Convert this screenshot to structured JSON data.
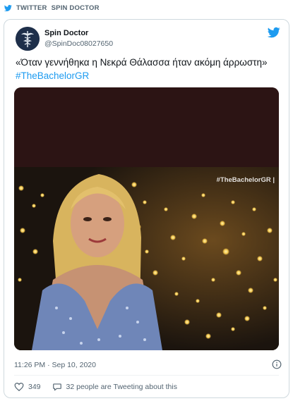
{
  "header": {
    "source": "TWITTER",
    "account": "SPIN DOCTOR"
  },
  "tweet": {
    "author_name": "Spin Doctor",
    "author_handle": "@SpinDoc08027650",
    "text": "«Όταν γεννήθηκα η Νεκρά Θάλασσα ήταν ακόμη άρρωστη» ",
    "hashtag": "#TheBachelorGR",
    "media_watermark": "#TheBachelorGR |",
    "timestamp": "11:26 PM · Sep 10, 2020",
    "likes": "349",
    "reply_text": "32 people are Tweeting about this"
  },
  "colors": {
    "accent": "#1d9bf0",
    "text": "#0f1419",
    "muted": "#536471",
    "border": "#cfd9de"
  },
  "icons": [
    "twitter-bird-icon",
    "heart-icon",
    "comment-icon",
    "info-icon"
  ]
}
